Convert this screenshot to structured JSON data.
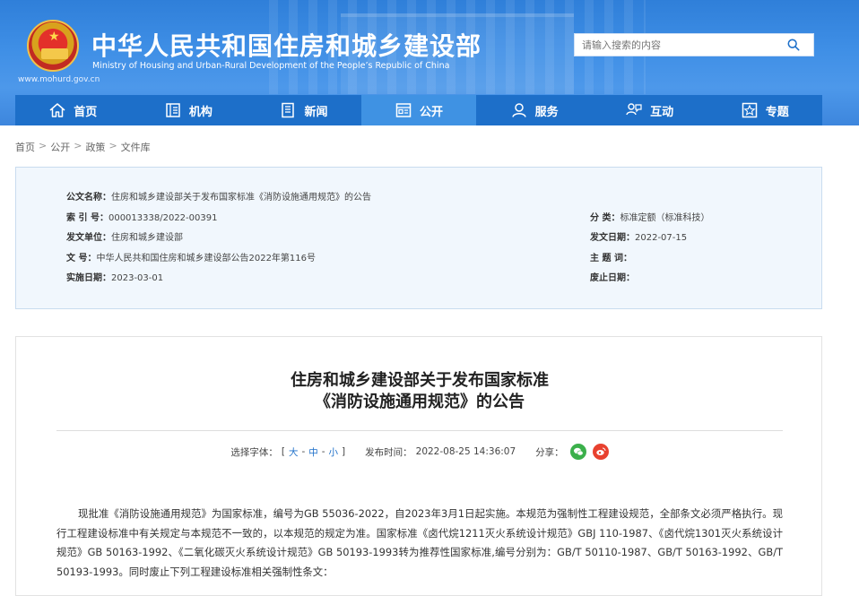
{
  "header": {
    "site_title": "中华人民共和国住房和城乡建设部",
    "site_subtitle": "Ministry of Housing and Urban-Rural Development of the People’s Republic of China",
    "site_url": "www.mohurd.gov.cn",
    "search_placeholder": "请输入搜索的内容"
  },
  "nav": {
    "items": [
      {
        "label": "首页",
        "icon": "home-icon"
      },
      {
        "label": "机构",
        "icon": "org-icon"
      },
      {
        "label": "新闻",
        "icon": "news-icon"
      },
      {
        "label": "公开",
        "icon": "disclosure-icon",
        "active": true
      },
      {
        "label": "服务",
        "icon": "service-icon"
      },
      {
        "label": "互动",
        "icon": "interaction-icon"
      },
      {
        "label": "专题",
        "icon": "topic-icon"
      }
    ]
  },
  "breadcrumb": [
    "首页",
    "公开",
    "政策",
    "文件库"
  ],
  "info": {
    "doc_name_label": "公文名称：",
    "doc_name": "住房和城乡建设部关于发布国家标准《消防设施通用规范》的公告",
    "index_label": "索  引  号：",
    "index": "000013338/2022-00391",
    "category_label": "分      类：",
    "category": "标准定额（标准科技）",
    "issuer_label": "发文单位：",
    "issuer": "住房和城乡建设部",
    "issue_date_label": "发文日期：",
    "issue_date": "2022-07-15",
    "doc_no_label": "文        号：",
    "doc_no": "中华人民共和国住房和城乡建设部公告2022年第116号",
    "subject_label": "主  题  词：",
    "subject": "",
    "effective_label": "实施日期：",
    "effective": "2023-03-01",
    "repeal_label": "废止日期：",
    "repeal": ""
  },
  "article": {
    "title_line1": "住房和城乡建设部关于发布国家标准",
    "title_line2": "《消防设施通用规范》的公告",
    "font_label": "选择字体：",
    "font_open": "[",
    "font_large": "大",
    "font_medium": "中",
    "font_small": "小",
    "font_dash1": " - ",
    "font_dash2": " - ",
    "font_close": "]",
    "publish_label": "发布时间：",
    "publish_time": "2022-08-25 14:36:07",
    "share_label": "分享：",
    "body": "现批准《消防设施通用规范》为国家标准，编号为GB 55036-2022，自2023年3月1日起实施。本规范为强制性工程建设规范，全部条文必须严格执行。现行工程建设标准中有关规定与本规范不一致的，以本规范的规定为准。国家标准《卤代烷1211灭火系统设计规范》GBJ 110-1987、《卤代烷1301灭火系统设计规范》GB 50163-1992、《二氧化碳灭火系统设计规范》GB 50193-1993转为推荐性国家标准,编号分别为：GB/T 50110-1987、GB/T 50163-1992、GB/T 50193-1993。同时废止下列工程建设标准相关强制性条文："
  },
  "colors": {
    "header_blue": "#3f8fe6",
    "nav_blue": "#1d6fc9",
    "nav_active": "#3f92e3",
    "link_blue": "#1d6fc9"
  }
}
